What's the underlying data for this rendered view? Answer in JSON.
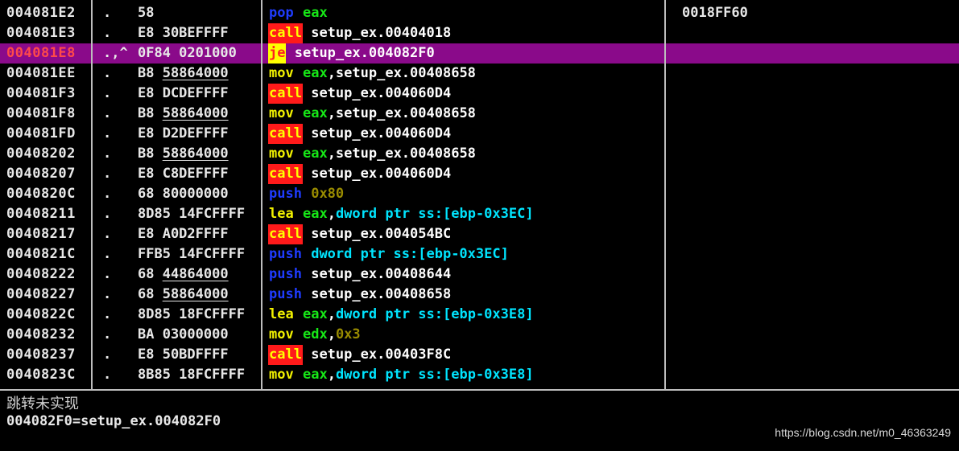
{
  "disassembly": {
    "rows": [
      {
        "address": "004081E2",
        "mark": ".",
        "hex": [
          [
            "58",
            false
          ]
        ],
        "mnemonic": "pop",
        "mn_style": "blue",
        "operands": [
          [
            "eax",
            "reg"
          ]
        ],
        "comment": "0018FF60",
        "selected": false
      },
      {
        "address": "004081E3",
        "mark": ".",
        "hex": [
          [
            "E8 30BEFFFF",
            false
          ]
        ],
        "mnemonic": "call",
        "mn_style": "call",
        "operands": [
          [
            "setup_ex.00404018",
            "op"
          ]
        ],
        "comment": "",
        "selected": false
      },
      {
        "address": "004081E8",
        "mark": ".,^",
        "hex": [
          [
            "0F84 0201000",
            false
          ]
        ],
        "mnemonic": "je",
        "mn_style": "je",
        "operands": [
          [
            "setup_ex.004082F0",
            "op"
          ]
        ],
        "comment": "",
        "selected": true
      },
      {
        "address": "004081EE",
        "mark": ".",
        "hex": [
          [
            "B8 ",
            false
          ],
          [
            "58864000",
            true
          ]
        ],
        "mnemonic": "mov",
        "mn_style": "yellow",
        "operands": [
          [
            "eax",
            "reg"
          ],
          [
            ",setup_ex.00408658",
            "op"
          ]
        ],
        "comment": "",
        "selected": false
      },
      {
        "address": "004081F3",
        "mark": ".",
        "hex": [
          [
            "E8 DCDEFFFF",
            false
          ]
        ],
        "mnemonic": "call",
        "mn_style": "call",
        "operands": [
          [
            "setup_ex.004060D4",
            "op"
          ]
        ],
        "comment": "",
        "selected": false
      },
      {
        "address": "004081F8",
        "mark": ".",
        "hex": [
          [
            "B8 ",
            false
          ],
          [
            "58864000",
            true
          ]
        ],
        "mnemonic": "mov",
        "mn_style": "yellow",
        "operands": [
          [
            "eax",
            "reg"
          ],
          [
            ",setup_ex.00408658",
            "op"
          ]
        ],
        "comment": "",
        "selected": false
      },
      {
        "address": "004081FD",
        "mark": ".",
        "hex": [
          [
            "E8 D2DEFFFF",
            false
          ]
        ],
        "mnemonic": "call",
        "mn_style": "call",
        "operands": [
          [
            "setup_ex.004060D4",
            "op"
          ]
        ],
        "comment": "",
        "selected": false
      },
      {
        "address": "00408202",
        "mark": ".",
        "hex": [
          [
            "B8 ",
            false
          ],
          [
            "58864000",
            true
          ]
        ],
        "mnemonic": "mov",
        "mn_style": "yellow",
        "operands": [
          [
            "eax",
            "reg"
          ],
          [
            ",setup_ex.00408658",
            "op"
          ]
        ],
        "comment": "",
        "selected": false
      },
      {
        "address": "00408207",
        "mark": ".",
        "hex": [
          [
            "E8 C8DEFFFF",
            false
          ]
        ],
        "mnemonic": "call",
        "mn_style": "call",
        "operands": [
          [
            "setup_ex.004060D4",
            "op"
          ]
        ],
        "comment": "",
        "selected": false
      },
      {
        "address": "0040820C",
        "mark": ".",
        "hex": [
          [
            "68 80000000",
            false
          ]
        ],
        "mnemonic": "push",
        "mn_style": "blue",
        "operands": [
          [
            "0x80",
            "num"
          ]
        ],
        "comment": "",
        "selected": false
      },
      {
        "address": "00408211",
        "mark": ".",
        "hex": [
          [
            "8D85 14FCFFFF",
            false
          ]
        ],
        "mnemonic": "lea",
        "mn_style": "yellow",
        "operands": [
          [
            "eax",
            "reg"
          ],
          [
            ",",
            "op"
          ],
          [
            "dword ptr ss:[ebp-0x3EC]",
            "mem"
          ]
        ],
        "comment": "",
        "selected": false
      },
      {
        "address": "00408217",
        "mark": ".",
        "hex": [
          [
            "E8 A0D2FFFF",
            false
          ]
        ],
        "mnemonic": "call",
        "mn_style": "call",
        "operands": [
          [
            "setup_ex.004054BC",
            "op"
          ]
        ],
        "comment": "",
        "selected": false
      },
      {
        "address": "0040821C",
        "mark": ".",
        "hex": [
          [
            "FFB5 14FCFFFF",
            false
          ]
        ],
        "mnemonic": "push",
        "mn_style": "blue",
        "operands": [
          [
            "dword ptr ss:[ebp-0x3EC]",
            "mem"
          ]
        ],
        "comment": "",
        "selected": false
      },
      {
        "address": "00408222",
        "mark": ".",
        "hex": [
          [
            "68 ",
            false
          ],
          [
            "44864000",
            true
          ]
        ],
        "mnemonic": "push",
        "mn_style": "blue",
        "operands": [
          [
            "setup_ex.00408644",
            "op"
          ]
        ],
        "comment": "",
        "selected": false
      },
      {
        "address": "00408227",
        "mark": ".",
        "hex": [
          [
            "68 ",
            false
          ],
          [
            "58864000",
            true
          ]
        ],
        "mnemonic": "push",
        "mn_style": "blue",
        "operands": [
          [
            "setup_ex.00408658",
            "op"
          ]
        ],
        "comment": "",
        "selected": false
      },
      {
        "address": "0040822C",
        "mark": ".",
        "hex": [
          [
            "8D85 18FCFFFF",
            false
          ]
        ],
        "mnemonic": "lea",
        "mn_style": "yellow",
        "operands": [
          [
            "eax",
            "reg"
          ],
          [
            ",",
            "op"
          ],
          [
            "dword ptr ss:[ebp-0x3E8]",
            "mem"
          ]
        ],
        "comment": "",
        "selected": false
      },
      {
        "address": "00408232",
        "mark": ".",
        "hex": [
          [
            "BA 03000000",
            false
          ]
        ],
        "mnemonic": "mov",
        "mn_style": "yellow",
        "operands": [
          [
            "edx",
            "reg"
          ],
          [
            ",",
            "op"
          ],
          [
            "0x3",
            "num"
          ]
        ],
        "comment": "",
        "selected": false
      },
      {
        "address": "00408237",
        "mark": ".",
        "hex": [
          [
            "E8 50BDFFFF",
            false
          ]
        ],
        "mnemonic": "call",
        "mn_style": "call",
        "operands": [
          [
            "setup_ex.00403F8C",
            "op"
          ]
        ],
        "comment": "",
        "selected": false
      },
      {
        "address": "0040823C",
        "mark": ".",
        "hex": [
          [
            "8B85 18FCFFFF",
            false
          ]
        ],
        "mnemonic": "mov",
        "mn_style": "yellow",
        "operands": [
          [
            "eax",
            "reg"
          ],
          [
            ",",
            "op"
          ],
          [
            "dword ptr ss:[ebp-0x3E8]",
            "mem"
          ]
        ],
        "comment": "",
        "selected": false
      }
    ]
  },
  "info_pane": {
    "title": "跳转未实现",
    "value": "004082F0=setup_ex.004082F0",
    "watermark": "https://blog.csdn.net/m0_46363249"
  }
}
